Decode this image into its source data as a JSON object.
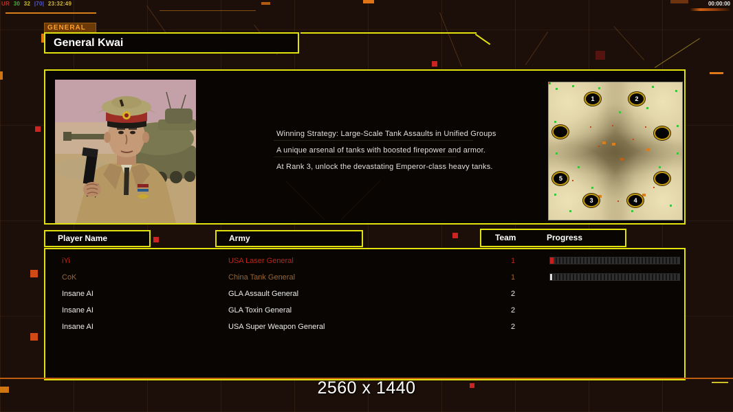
{
  "status_overlay": {
    "debug_segments": [
      {
        "text": "UR",
        "color": "#c23028"
      },
      {
        "text": "30",
        "color": "#38b838"
      },
      {
        "text": "32",
        "color": "#c8c030"
      },
      {
        "text": "|70|",
        "color": "#5058c8"
      },
      {
        "text": "23:32:49",
        "color": "#d0b838"
      }
    ],
    "match_timer": "00:00:00",
    "resolution_label": "2560 x 1440"
  },
  "general_panel": {
    "tab_label": "GENERAL",
    "general_name": "General Kwai",
    "strategy_lines": [
      "Winning Strategy: Large-Scale Tank Assaults in Unified Groups",
      "A unique arsenal of tanks with boosted firepower and armor.",
      "At Rank 3, unlock the devastating Emperor-class heavy tanks."
    ]
  },
  "minimap": {
    "spot_labels": [
      "1",
      "2",
      "",
      "",
      "5",
      "",
      "3",
      "4"
    ]
  },
  "lobby_table": {
    "headers": {
      "player": "Player Name",
      "army": "Army",
      "team": "Team",
      "progress": "Progress"
    },
    "rows": [
      {
        "player": "iYi",
        "army": "USA Laser General",
        "team": "1",
        "color": "#c02418",
        "progress_width": 5,
        "progress_color": "#c82020"
      },
      {
        "player": "CoK",
        "army": "China Tank General",
        "team": "1",
        "color": "#9c6530",
        "progress_width": 3,
        "progress_color": "#e0e0e0"
      },
      {
        "player": "Insane AI",
        "army": "GLA Assault General",
        "team": "2",
        "color": "#ececec"
      },
      {
        "player": "Insane AI",
        "army": "GLA Toxin General",
        "team": "2",
        "color": "#ececec"
      },
      {
        "player": "Insane AI",
        "army": "USA Super Weapon General",
        "team": "2",
        "color": "#ececec"
      }
    ]
  }
}
